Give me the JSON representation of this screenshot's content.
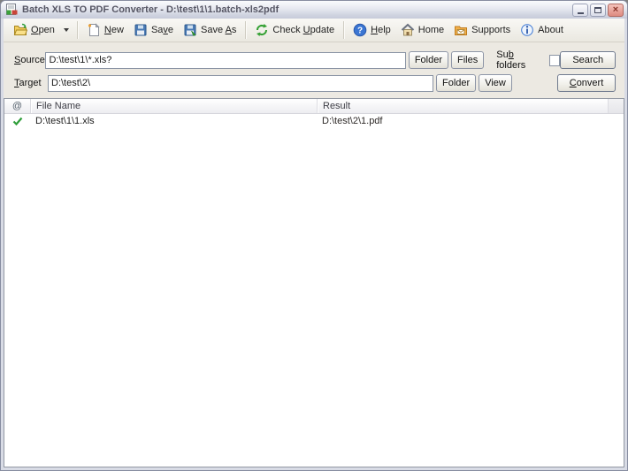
{
  "window": {
    "title": "Batch XLS TO PDF Converter - D:\\test\\1\\1.batch-xls2pdf"
  },
  "toolbar": {
    "open": {
      "pre": "",
      "accel": "O",
      "post": "pen"
    },
    "new": {
      "pre": "",
      "accel": "N",
      "post": "ew"
    },
    "save": {
      "pre": "Sa",
      "accel": "v",
      "post": "e"
    },
    "save_as": {
      "pre": "Save ",
      "accel": "A",
      "post": "s"
    },
    "check_update": {
      "pre": "Check ",
      "accel": "U",
      "post": "pdate"
    },
    "help": {
      "pre": "",
      "accel": "H",
      "post": "elp"
    },
    "home": {
      "label": "Home"
    },
    "supports": {
      "label": "Supports"
    },
    "about": {
      "label": "About"
    }
  },
  "source_row": {
    "label": {
      "pre": "",
      "accel": "S",
      "post": "ource"
    },
    "value": "D:\\test\\1\\*.xls?",
    "folder_button": "Folder",
    "files_button": "Files",
    "sub_folders": {
      "pre": "Su",
      "accel": "b",
      "post": " folders"
    },
    "sub_folders_checked": false,
    "search_button": "Search"
  },
  "target_row": {
    "label": {
      "pre": "",
      "accel": "T",
      "post": "arget"
    },
    "value": "D:\\test\\2\\",
    "folder_button": "Folder",
    "view_button": "View",
    "convert_button": {
      "pre": "",
      "accel": "C",
      "post": "onvert"
    }
  },
  "file_list": {
    "columns": [
      "@",
      "File Name",
      "Result"
    ],
    "rows": [
      {
        "status_icon": "green-check-icon",
        "file_name": "D:\\test\\1\\1.xls",
        "result": "D:\\test\\2\\1.pdf"
      }
    ]
  },
  "icons": {
    "app": "xls-to-pdf-app-icon",
    "open": "open-folder-icon",
    "new": "new-document-icon",
    "save": "save-floppy-icon",
    "save_as": "save-as-floppy-icon",
    "check_update": "refresh-arrows-icon",
    "help": "help-question-icon",
    "home": "home-house-icon",
    "supports": "supports-folder-icon",
    "about": "about-info-icon",
    "open_dropdown": "chevron-down-icon",
    "row_status": "green-check-icon"
  },
  "colors": {
    "success_check": "#2f9e3a",
    "titlebar_text": "#565664",
    "close_button": "#de8b81",
    "panel_bg": "#ece9e2",
    "input_border": "#8a94a4"
  }
}
